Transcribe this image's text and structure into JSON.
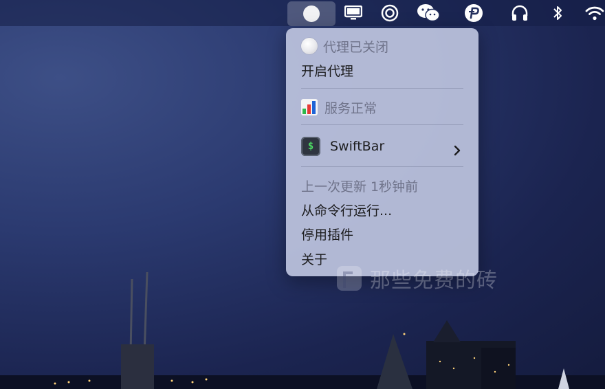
{
  "menubar": {
    "icons": [
      "status-dot-icon",
      "display-icon",
      "target-icon",
      "wechat-icon",
      "proxy-p-icon",
      "headphones-icon",
      "bluetooth-icon",
      "wifi-icon"
    ]
  },
  "menu": {
    "status_label": "代理已关闭",
    "enable_proxy": "开启代理",
    "service_status": "服务正常",
    "swiftbar_label": "SwiftBar",
    "swiftbar_icon_text": "$",
    "last_update": "上一次更新 1秒钟前",
    "run_from_cli": "从命令行运行...",
    "disable_plugin": "停用插件",
    "about": "关于"
  },
  "watermark": {
    "text": "那些免费的砖"
  },
  "colors": {
    "menu_bg": "#bec4de",
    "menu_text": "#1d1d1f",
    "menu_dim_text": "#6f738a",
    "swiftbar_green": "#4cd964",
    "chart_green": "#2db84c",
    "chart_red": "#e53935",
    "chart_blue": "#1e63d6"
  }
}
